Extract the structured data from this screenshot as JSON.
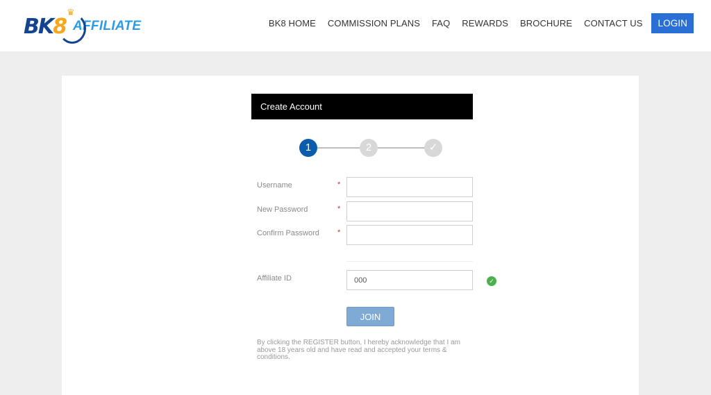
{
  "header": {
    "logo": {
      "brand": "BK",
      "brand_digit": "8",
      "suffix": "AFFILIATE"
    },
    "nav": [
      {
        "label": "BK8 HOME"
      },
      {
        "label": "COMMISSION PLANS"
      },
      {
        "label": "FAQ"
      },
      {
        "label": "REWARDS"
      },
      {
        "label": "BROCHURE"
      },
      {
        "label": "CONTACT US"
      }
    ],
    "login_label": "LOGIN"
  },
  "form": {
    "title": "Create Account",
    "steps": [
      {
        "label": "1",
        "state": "active"
      },
      {
        "label": "2",
        "state": "inactive"
      },
      {
        "label": "✓",
        "state": "inactive"
      }
    ],
    "fields": [
      {
        "label": "Username",
        "required_mark": "*",
        "value": ""
      },
      {
        "label": "New Password",
        "required_mark": "*",
        "value": ""
      },
      {
        "label": "Confirm Password",
        "required_mark": "*",
        "value": ""
      }
    ],
    "affiliate": {
      "label": "Affiliate ID",
      "value": "000",
      "status_icon": "✓"
    },
    "join_label": "JOIN",
    "terms": "By clicking the REGISTER button, I hereby acknowledge that I am above 18 years old and have read and accepted your terms & conditions."
  },
  "colors": {
    "accent": "#2a6fd6",
    "step_active": "#0b5cad",
    "success": "#4cae4c",
    "join": "#7faad6"
  }
}
